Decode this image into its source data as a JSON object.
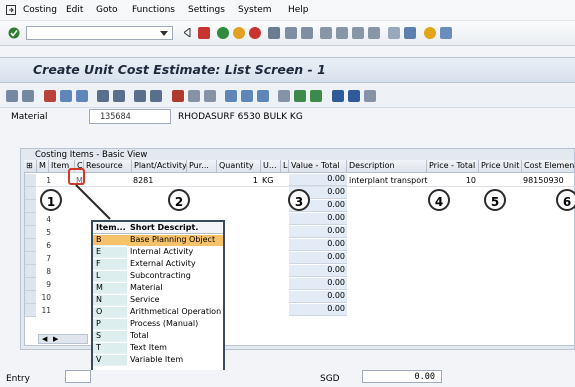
{
  "menu": [
    "Costing",
    "Edit",
    "Goto",
    "Functions",
    "Settings",
    "System",
    "Help"
  ],
  "title": "Create Unit Cost Estimate: List Screen - 1",
  "material": {
    "label": "Material",
    "value": "135684",
    "description": "RHODASURF 6530 BULK KG"
  },
  "table": {
    "panel_title": "Costing Items - Basic View",
    "headers": [
      "Item",
      "C",
      "Resource",
      "Plant/Activity",
      "Pur...",
      "Quantity",
      "U...",
      "L",
      "Value - Total",
      "Description",
      "Price - Total",
      "Price Unit",
      "Cost Element"
    ],
    "rows": [
      {
        "item": "1",
        "c": "M",
        "plant": "8281",
        "quantity": "1",
        "unit": "KG",
        "value": "0.00",
        "description": "interplant transport",
        "price_total": "10",
        "cost_element": "98150930"
      },
      {
        "item": "2",
        "value": "0.00"
      },
      {
        "item": "3",
        "value": "0.00"
      },
      {
        "item": "4",
        "value": "0.00"
      },
      {
        "item": "5",
        "value": "0.00"
      },
      {
        "item": "6",
        "value": "0.00"
      },
      {
        "item": "7",
        "value": "0.00"
      },
      {
        "item": "8",
        "value": "0.00"
      },
      {
        "item": "9",
        "value": "0.00"
      },
      {
        "item": "10",
        "value": "0.00"
      },
      {
        "item": "11",
        "value": "0.00"
      }
    ]
  },
  "callouts": [
    "1",
    "2",
    "3",
    "4",
    "5",
    "6"
  ],
  "popup": {
    "headers": {
      "code": "Item...",
      "desc": "Short Descript."
    },
    "items": [
      {
        "code": "B",
        "desc": "Base Planning Object"
      },
      {
        "code": "E",
        "desc": "Internal Activity"
      },
      {
        "code": "F",
        "desc": "External Activity"
      },
      {
        "code": "L",
        "desc": "Subcontracting"
      },
      {
        "code": "M",
        "desc": "Material"
      },
      {
        "code": "N",
        "desc": "Service"
      },
      {
        "code": "O",
        "desc": "Arithmetical Operation"
      },
      {
        "code": "P",
        "desc": "Process (Manual)"
      },
      {
        "code": "S",
        "desc": "Total"
      },
      {
        "code": "T",
        "desc": "Text Item"
      },
      {
        "code": "V",
        "desc": "Variable Item"
      }
    ]
  },
  "footer": {
    "entry_label": "Entry",
    "currency": "SGD",
    "total": "0.00"
  },
  "colors": {
    "selected": "#f6c26a",
    "value_column": "#e3ecf6",
    "code_column": "#dcefee"
  }
}
